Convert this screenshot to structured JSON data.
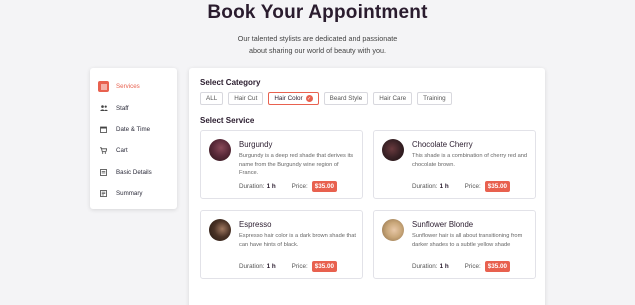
{
  "header": {
    "title": "Book Your Appointment",
    "subtitle_line1": "Our talented stylists are dedicated and passionate",
    "subtitle_line2": "about sharing our world of beauty with you."
  },
  "sidebar": {
    "items": [
      {
        "label": "Services",
        "icon": "list-icon",
        "active": true
      },
      {
        "label": "Staff",
        "icon": "people-icon",
        "active": false
      },
      {
        "label": "Date & Time",
        "icon": "calendar-icon",
        "active": false
      },
      {
        "label": "Cart",
        "icon": "cart-icon",
        "active": false
      },
      {
        "label": "Basic Details",
        "icon": "form-icon",
        "active": false
      },
      {
        "label": "Summary",
        "icon": "summary-icon",
        "active": false
      }
    ]
  },
  "main": {
    "category_title": "Select Category",
    "categories": [
      {
        "label": "ALL",
        "active": false
      },
      {
        "label": "Hair Cut",
        "active": false
      },
      {
        "label": "Hair Color",
        "active": true
      },
      {
        "label": "Beard Style",
        "active": false
      },
      {
        "label": "Hair Care",
        "active": false
      },
      {
        "label": "Training",
        "active": false
      }
    ],
    "service_title": "Select Service",
    "services": [
      {
        "name": "Burgundy",
        "description": "Burgundy is a deep red shade that derives its name from the Burgundy wine region of France.",
        "duration_label": "Duration:",
        "duration": "1 h",
        "price_label": "Price:",
        "price": "$35.00",
        "avatar_color": "#5a2a3a"
      },
      {
        "name": "Chocolate Cherry",
        "description": "This shade is a combination of cherry red and chocolate brown.",
        "duration_label": "Duration:",
        "duration": "1 h",
        "price_label": "Price:",
        "price": "$35.00",
        "avatar_color": "#3a2226"
      },
      {
        "name": "Espresso",
        "description": "Espresso hair color is a dark brown shade that can have hints of black.",
        "duration_label": "Duration:",
        "duration": "1 h",
        "price_label": "Price:",
        "price": "$35.00",
        "avatar_color": "#3b2a22"
      },
      {
        "name": "Sunflower Blonde",
        "description": "Sunflower hair is all about transitioning from darker shades to a subtle yellow shade",
        "duration_label": "Duration:",
        "duration": "1 h",
        "price_label": "Price:",
        "price": "$35.00",
        "avatar_color": "#c9a77a"
      }
    ]
  },
  "colors": {
    "accent": "#e8614f",
    "title": "#2a1c2e",
    "background": "#f4f4f6"
  }
}
